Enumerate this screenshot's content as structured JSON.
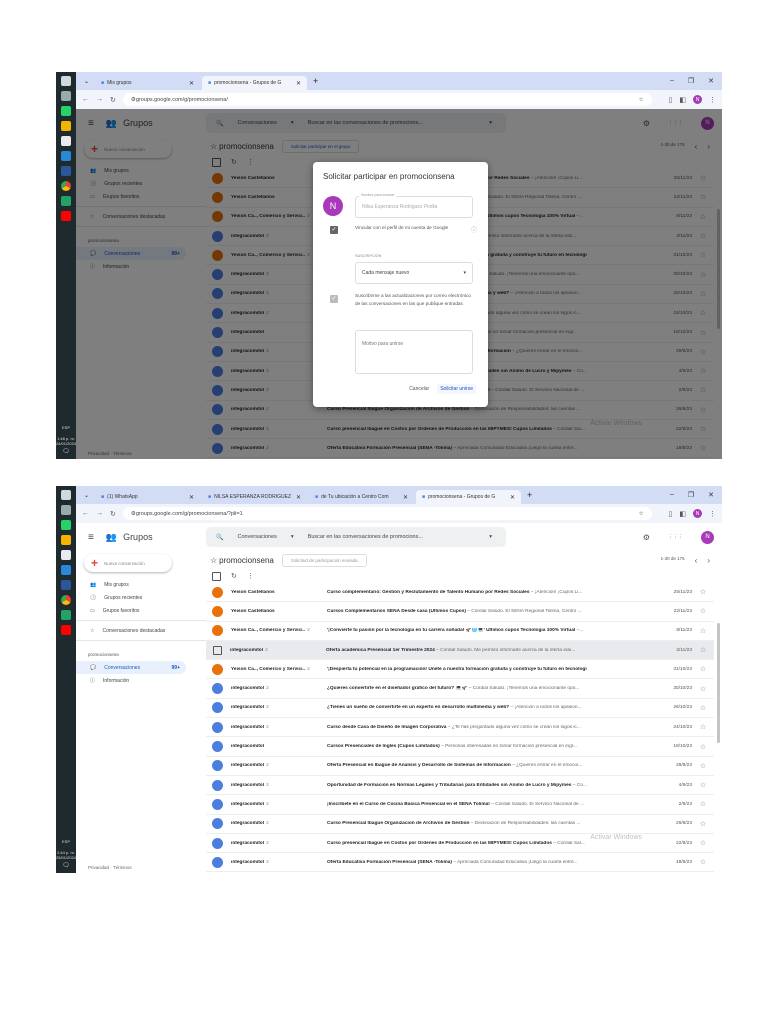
{
  "screenshots": [
    {
      "tabs": [
        {
          "label": "Mis grupos"
        },
        {
          "label": "promocionsena - Grupos de G"
        }
      ],
      "active_tab": 1,
      "url": "groups.google.com/g/promocionsena/",
      "clock_time": "1:48 p. m.",
      "clock_date": "24/01/2024",
      "join_label": "Solicitar participar en el grupo",
      "join_sent": false,
      "dialog": true
    },
    {
      "tabs": [
        {
          "label": "(1) WhatsApp"
        },
        {
          "label": "NILSA ESPERANZA RODRIGUEZ"
        },
        {
          "label": "de Tu ubicación a Centro Com"
        },
        {
          "label": "promocionsena - Grupos de G"
        }
      ],
      "active_tab": 3,
      "url": "groups.google.com/g/promocionsena/?pli=1",
      "clock_time": "2:44 p. m.",
      "clock_date": "25/01/2024",
      "join_label": "Solicitud de participación enviada",
      "join_sent": true,
      "dialog": false
    }
  ],
  "common": {
    "app_name": "Grupos",
    "search_scope": "Conversaciones",
    "search_placeholder": "Buscar en las conversaciones de promocions...",
    "avatar_letter": "N",
    "new_conversation": "Nueva conversación",
    "sidebar": [
      "Mis grupos",
      "Grupos recientes",
      "Grupos favoritos"
    ],
    "starred": "Conversaciones destacadas",
    "group_section": "promocionsena",
    "conversations_label": "Conversaciones",
    "conversations_badge": "99+",
    "info_label": "Información",
    "footer": "Privacidad · Términos",
    "group_name": "promocionsena",
    "pager": "1-30 de 176",
    "lang": "ESP",
    "watermark": "Activar Windows"
  },
  "dialog": {
    "title": "Solicitar participar en promocionsena",
    "name_label": "Nombre para mostrar",
    "name_value": "Nilsa Esperanza Rodriguez Pinilla",
    "link_profile": "Vincular con el perfil de mi cuenta de Google",
    "subscription_label": "SUSCRIPCIÓN",
    "subscription_value": "Cada mensaje nuevo",
    "subscribe_updates": "Suscribirme a las actualizaciones por correo electrónico de las conversaciones en las que publique entradas",
    "reason_placeholder": "Motivo para unirse",
    "cancel": "Cancelar",
    "submit": "Solicitar unirse"
  },
  "conversations": [
    {
      "sender": "Yeison Castellanos",
      "count": "",
      "avatar": "o",
      "subject": "Curso complementario: Gestión y Reclutamiento de Talento Humano por Redes Sociales",
      "snippet": " – ¡Atención! ¡Cupos Li...",
      "date": "25/11/23"
    },
    {
      "sender": "Yeison Castellanos",
      "count": "",
      "avatar": "o",
      "subject": "Cursos Complementarios SENA Desde casa (Ultimos Cupos)",
      "snippet": " – Cordial Saludo. El SENA Regional Tolima, Centro ...",
      "date": "22/11/23"
    },
    {
      "sender": "Yeison Ca.., Comercio y Servici..",
      "count": "2",
      "avatar": "o",
      "subject": "'¡Convierte tu pasión por la tecnología en tu carrera soñada! 🚀🌐💻' Ultimos cupos Tecnologia 100% Virtual",
      "snippet": " –...",
      "date": "8/11/23"
    },
    {
      "sender": "integracomitol",
      "count": "2",
      "avatar": "b",
      "subject": "Oferta academica Presencial 1er Trimestre 2024",
      "snippet": " – Cordial Saludo. Me permito informarle acerca de la oferta edu...",
      "date": "2/11/23"
    },
    {
      "sender": "Yeison Ca.., Comercio y Servici..",
      "count": "2",
      "avatar": "o",
      "subject": "'¡Despierta tu potencial en la programación! Únete a nuestra formación gratuita y construye tu futuro en tecnologí",
      "snippet": "",
      "date": "31/10/23"
    },
    {
      "sender": "integracomitol",
      "count": "2",
      "avatar": "b",
      "subject": "¿Quieres convertirte en el diseñador gráfico del futuro? 💻🚀",
      "snippet": " – Cordial Saludo. ¡Tenemos una emocionante opo...",
      "date": "30/10/23"
    },
    {
      "sender": "integracomitol",
      "count": "2",
      "avatar": "b",
      "subject": "¿Tienes un sueño de convertirte en un experto en desarrollo multimedia y web?",
      "snippet": " – ¡Atención a todos los apasion...",
      "date": "26/10/23"
    },
    {
      "sender": "integracomitol",
      "count": "2",
      "avatar": "b",
      "subject": "Curso desde Casa de Diseño de Imagen Corporativa",
      "snippet": " – ¿Te has preguntado alguna vez cómo se crean los logos ic...",
      "date": "24/10/23"
    },
    {
      "sender": "integracomitol",
      "count": "",
      "avatar": "b",
      "subject": "Cursos Presenciales de Ingles (Cupos Limitados)",
      "snippet": " – Personas interesadas en tomar formación presencial en ingl...",
      "date": "18/10/23"
    },
    {
      "sender": "integracomitol",
      "count": "2",
      "avatar": "b",
      "subject": "Oferta Presencial en Ibague de Analisis y Desarrollo de Sistemas de Informacion",
      "snippet": " – ¿Quieres entrar en el emocio...",
      "date": "29/9/23"
    },
    {
      "sender": "integracomitol",
      "count": "2",
      "avatar": "b",
      "subject": "Oportunidad de Formación en Normas Legales y Tributarias para Entidades sin Ánimo de Lucro y Mipymes",
      "snippet": " – Co...",
      "date": "4/9/23"
    },
    {
      "sender": "integracomitol",
      "count": "2",
      "avatar": "b",
      "subject": "¡Inscríbete en el Curso de Cocina Básica Presencial en el SENA Tolima!",
      "snippet": " – Cordial Saludo. El Servicio Nacional de ...",
      "date": "2/9/23"
    },
    {
      "sender": "integracomitol",
      "count": "2",
      "avatar": "b",
      "subject": "Curso Presencial Ibague Organizacion de Archivos de Gestion",
      "snippet": " – Declinación de Responsabilidades: las cuentas ...",
      "date": "26/8/23"
    },
    {
      "sender": "integracomitol",
      "count": "2",
      "avatar": "b",
      "subject": "Curso presencial Ibague en Costos por Órdenes de Producción en las MIPYMES! Cupos Limitados",
      "snippet": " – Cordial Sal...",
      "date": "22/8/23"
    },
    {
      "sender": "integracomitol",
      "count": "2",
      "avatar": "b",
      "subject": "Oferta Educativa Formación Presencial (SENA -Tolima)",
      "snippet": " – Apreciada Comunidad Educativa ¡Llegó la cuarta entre...",
      "date": "18/8/23"
    }
  ],
  "hover_row_index": 3,
  "colors": {
    "accent": "#1a55c4",
    "avatar": "#a63ab8",
    "tabbar": "#d3dcf5"
  }
}
